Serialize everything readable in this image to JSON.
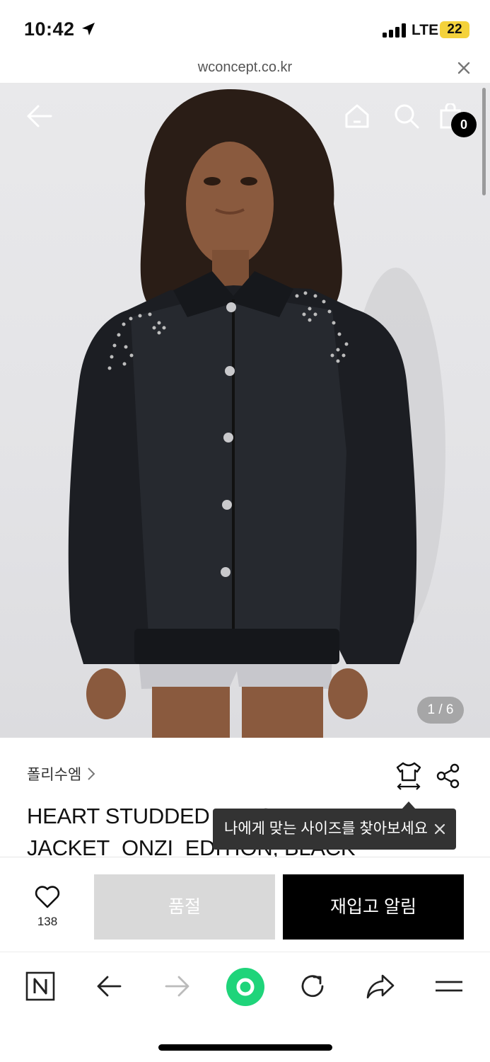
{
  "status_bar": {
    "time": "10:42",
    "network": "LTE",
    "battery": "22"
  },
  "browser": {
    "url": "wconcept.co.kr"
  },
  "header": {
    "cart_count": "0"
  },
  "gallery": {
    "pager": "1 / 6"
  },
  "product": {
    "brand": "폴리수엠",
    "title_line1": "HEART STUDDED VARSITY",
    "title_line2": "JACKET_ONZI_EDITION, BLACK"
  },
  "tooltip": {
    "text": "나에게 맞는 사이즈를 찾아보세요"
  },
  "actions": {
    "like_count": "138",
    "soldout_label": "품절",
    "restock_label": "재입고 알림"
  },
  "colors": {
    "accent_green": "#1fd47a",
    "dark": "#000000",
    "disabled": "#d9d9d9"
  },
  "icons": [
    "back-arrow-icon",
    "home-icon",
    "search-icon",
    "cart-icon",
    "size-guide-icon",
    "share-icon",
    "heart-icon",
    "naver-icon",
    "forward-icon",
    "reload-icon",
    "menu-icon"
  ]
}
